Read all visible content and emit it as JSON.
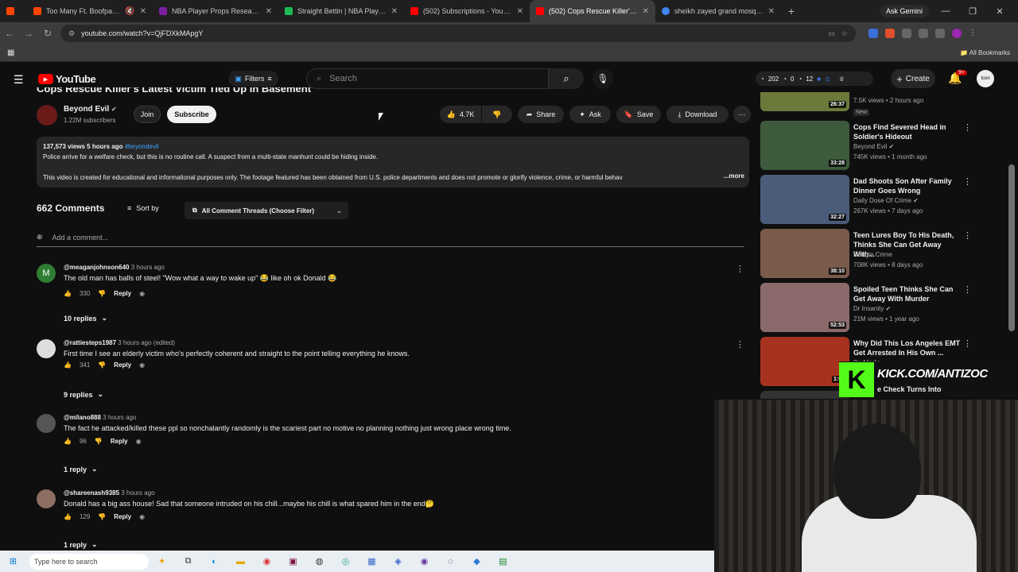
{
  "browser": {
    "tabs": [
      {
        "title": "Too Many Ft. Boofpaxkmo",
        "color": "#ff4500"
      },
      {
        "title": "NBA Player Props Research | Pr",
        "color": "#7a1fa2"
      },
      {
        "title": "Straight Bettin | NBA Player Pr",
        "color": "#1db954"
      },
      {
        "title": "(502) Subscriptions - YouTube",
        "color": "#ff0000"
      },
      {
        "title": "(502) Cops Rescue Killer's Late",
        "color": "#ff0000"
      },
      {
        "title": "sheikh zayed grand mosque - G",
        "color": "#4285f4"
      }
    ],
    "ask_gemini": "Ask Gemini",
    "url": "youtube.com/watch?v=QjFDXkMApgY",
    "all_bookmarks": "All Bookmarks"
  },
  "header": {
    "logo_text": "YouTube",
    "filters": "Filters",
    "search_placeholder": "Search",
    "stats": {
      "a": "202",
      "b": "0",
      "c": "12"
    },
    "create": "Create",
    "notif_count": "9+",
    "avatar_text": "Icon"
  },
  "video": {
    "title": "Cops Rescue Killer's Latest Victim Tied Up In Basement",
    "channel": "Beyond Evil",
    "subs": "1.22M subscribers",
    "join": "Join",
    "subscribe": "Subscribe",
    "likes": "4.7K",
    "share": "Share",
    "ask": "Ask",
    "save": "Save",
    "download": "Download",
    "views_line": "137,573 views  5 hours ago",
    "hashtag": "#beyondevil",
    "desc1": "Police arrive for a welfare check, but this is no routine call. A suspect from a multi-state manhunt could be hiding inside.",
    "desc2": "This video is created for educational and informational purposes only. The footage featured has been obtained from U.S. police departments and does not promote or glorify violence, crime, or harmful behav",
    "more": "...more"
  },
  "comments_section": {
    "count": "662 Comments",
    "sort_by": "Sort by",
    "filter_label": "All Comment Threads (Choose Filter)",
    "add_placeholder": "Add a comment...",
    "comments": [
      {
        "user": "@meaganjohnson640",
        "ago": "3 hours ago",
        "text": "The old man has balls of steel! \"Wow what a way to wake up\" 😂 like oh ok Donald 😂",
        "likes": "330",
        "reply": "Reply",
        "replies": "10 replies",
        "avatar": "M",
        "color": "#2e7d32"
      },
      {
        "user": "@rattiesteps1987",
        "ago": "3 hours ago (edited)",
        "text": "First time I see an elderly victim who's perfectly coherent and straight to the point telling everything he knows.",
        "likes": "341",
        "reply": "Reply",
        "replies": "9 replies",
        "avatar": "",
        "color": "#dddddd"
      },
      {
        "user": "@milano888",
        "ago": "3 hours ago",
        "text": "The fact he attacked/killed these ppl so nonchalantly randomly is the scariest part no motive no planning nothing just wrong place wrong time.",
        "likes": "96",
        "reply": "Reply",
        "replies": "1 reply",
        "avatar": "",
        "color": "#555555"
      },
      {
        "user": "@shareenash9385",
        "ago": "3 hours ago",
        "text": "Donald has a big ass house! Sad that someone intruded on his chill...maybe his chill is what spared him in the end🤔",
        "likes": "129",
        "reply": "Reply",
        "replies": "1 reply",
        "avatar": "",
        "color": "#8d6e63"
      }
    ]
  },
  "sidebar": {
    "items": [
      {
        "title": "",
        "channel": "",
        "views": "7.5K views • 2 hours ago",
        "badge": "New",
        "duration": "26:37",
        "color": "#6b7a3a"
      },
      {
        "title": "Cops Find Severed Head in Soldier's Hideout",
        "channel": "Beyond Evil",
        "views": "745K views • 1 month ago",
        "duration": "33:28",
        "color": "#3d5a3c"
      },
      {
        "title": "Dad Shoots Son After Family Dinner Goes Wrong",
        "channel": "Daily Dose Of Crime",
        "views": "267K views • 7 days ago",
        "duration": "32:27",
        "color": "#4a5c7a"
      },
      {
        "title": "Teen Lures Boy To His Death, Thinks She Can Get Away With...",
        "channel": "Dangle Crime",
        "views": "708K views • 8 days ago",
        "duration": "38:10",
        "color": "#7a5a4a"
      },
      {
        "title": "Spoiled Teen Thinks She Can Get Away With Murder",
        "channel": "Dr Insanity",
        "views": "21M views • 1 year ago",
        "duration": "52:53",
        "color": "#8a6a6a"
      },
      {
        "title": "Why Did This Los Angeles EMT Get Arrested In His Own ...",
        "channel": "PorMedic",
        "views": "",
        "duration": "1:00",
        "color": "#a83220"
      }
    ],
    "last_partial": "e Check Turns Into"
  },
  "stream": {
    "kick_letter": "K",
    "kick_text": "KICK.COM/ANTIZOC"
  },
  "taskbar": {
    "search_text": "Type here to search"
  }
}
